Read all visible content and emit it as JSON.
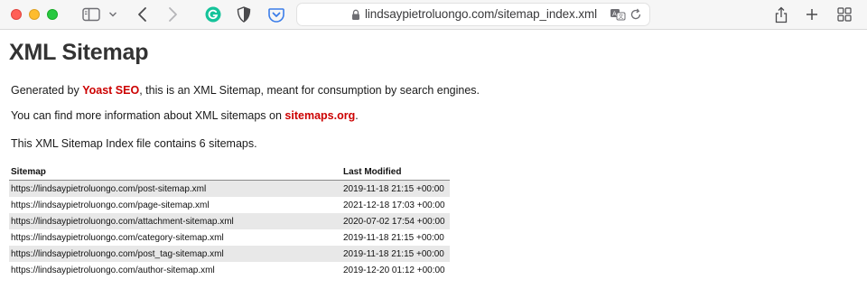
{
  "browser": {
    "url_display": "lindsaypietroluongo.com/sitemap_index.xml",
    "traffic_lights": [
      "close",
      "minimize",
      "zoom"
    ],
    "toolbar_icons": [
      "sidebar-icon",
      "chevron-down-icon",
      "back-icon",
      "forward-icon",
      "grammarly-icon",
      "privacy-shield-icon",
      "pocket-icon",
      "lock-icon",
      "translate-icon",
      "reload-icon",
      "share-icon",
      "new-tab-icon",
      "tab-overview-icon"
    ],
    "colors": {
      "close": "#ff5f57",
      "minimize": "#febc2e",
      "zoom": "#28c840",
      "grammarly": "#15c39a",
      "pocket": "#3b7de9"
    }
  },
  "page": {
    "title": "XML Sitemap",
    "intro": {
      "prefix": "Generated by ",
      "link1": "Yoast SEO",
      "suffix": ", this is an XML Sitemap, meant for consumption by search engines."
    },
    "info": {
      "prefix": "You can find more information about XML sitemaps on ",
      "link": "sitemaps.org",
      "suffix": "."
    },
    "count_text": "This XML Sitemap Index file contains 6 sitemaps.",
    "link_color": "#cc0000",
    "table": {
      "headers": {
        "sitemap": "Sitemap",
        "modified": "Last Modified"
      },
      "rows": [
        {
          "url": "https://lindsaypietroluongo.com/post-sitemap.xml",
          "modified": "2019-11-18 21:15 +00:00"
        },
        {
          "url": "https://lindsaypietroluongo.com/page-sitemap.xml",
          "modified": "2021-12-18 17:03 +00:00"
        },
        {
          "url": "https://lindsaypietroluongo.com/attachment-sitemap.xml",
          "modified": "2020-07-02 17:54 +00:00"
        },
        {
          "url": "https://lindsaypietroluongo.com/category-sitemap.xml",
          "modified": "2019-11-18 21:15 +00:00"
        },
        {
          "url": "https://lindsaypietroluongo.com/post_tag-sitemap.xml",
          "modified": "2019-11-18 21:15 +00:00"
        },
        {
          "url": "https://lindsaypietroluongo.com/author-sitemap.xml",
          "modified": "2019-12-20 01:12 +00:00"
        }
      ]
    }
  }
}
